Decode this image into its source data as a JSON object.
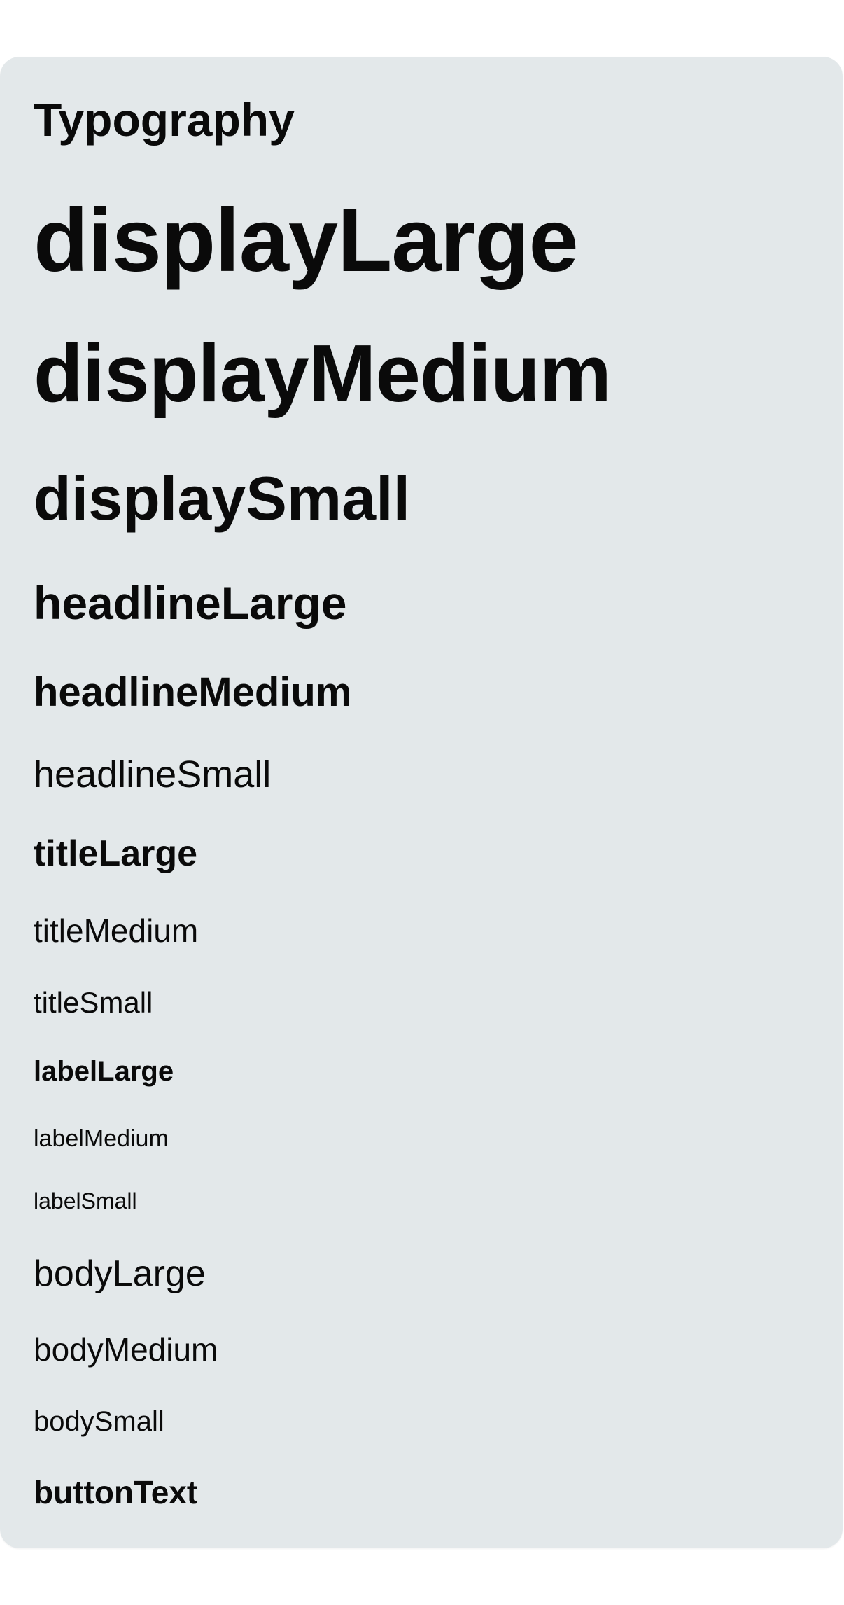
{
  "card": {
    "title": "Typography",
    "styles": {
      "displayLarge": "displayLarge",
      "displayMedium": "displayMedium",
      "displaySmall": "displaySmall",
      "headlineLarge": "headlineLarge",
      "headlineMedium": "headlineMedium",
      "headlineSmall": "headlineSmall",
      "titleLarge": "titleLarge",
      "titleMedium": "titleMedium",
      "titleSmall": "titleSmall",
      "labelLarge": "labelLarge",
      "labelMedium": "labelMedium",
      "labelSmall": "labelSmall",
      "bodyLarge": "bodyLarge",
      "bodyMedium": "bodyMedium",
      "bodySmall": "bodySmall",
      "buttonText": "buttonText"
    }
  },
  "colors": {
    "background": "#ffffff",
    "card": "#e3e8ea",
    "text": "#0a0a0a"
  }
}
